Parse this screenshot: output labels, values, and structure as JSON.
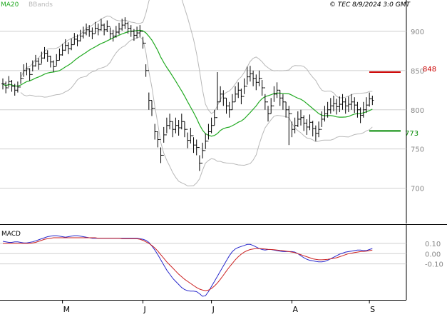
{
  "header": {
    "legend_ma20": "MA20",
    "legend_bbands": "BBands",
    "source": "© TEC 8/9/2024 3:0 GMT"
  },
  "colors": {
    "background": "#ffffff",
    "price_bar": "#000000",
    "ma20": "#22aa22",
    "bbands": "#b8b8b8",
    "grid": "#cfcfcf",
    "resistance": "#cc0000",
    "support": "#008800",
    "macd_line": "#2a2acc",
    "signal_line": "#cc2222",
    "axis_text": "#888888"
  },
  "levels": {
    "resistance_label": "848",
    "support_label": "773"
  },
  "x_axis": {
    "month_labels": [
      "M",
      "J",
      "J",
      "A",
      "S"
    ]
  },
  "chart_data": [
    {
      "type": "line",
      "subtype": "ohlc-bars",
      "title": "",
      "xlabel": "",
      "ylabel": "",
      "y_ticks": [
        "900",
        "850",
        "800",
        "750",
        "700"
      ],
      "ylim": [
        655,
        940
      ],
      "grid": true,
      "legend": "top-left",
      "resistance": 848,
      "support": 773,
      "month_labels": [
        "M",
        "J",
        "J",
        "A",
        "S"
      ],
      "month_label_bar_index": [
        20,
        47,
        70,
        97,
        123
      ],
      "close": [
        833,
        828,
        836,
        830,
        825,
        829,
        840,
        850,
        852,
        845,
        856,
        862,
        858,
        866,
        872,
        868,
        861,
        855,
        863,
        870,
        876,
        882,
        878,
        883,
        890,
        888,
        894,
        898,
        902,
        900,
        897,
        904,
        902,
        908,
        902,
        906,
        897,
        894,
        899,
        903,
        908,
        910,
        904,
        900,
        895,
        898,
        900,
        885,
        850,
        812,
        802,
        772,
        762,
        742,
        768,
        780,
        785,
        775,
        780,
        777,
        785,
        775,
        761,
        767,
        755,
        752,
        732,
        748,
        760,
        772,
        780,
        790,
        810,
        820,
        815,
        805,
        800,
        810,
        820,
        825,
        817,
        830,
        842,
        846,
        840,
        835,
        840,
        828,
        810,
        795,
        805,
        820,
        825,
        815,
        810,
        800,
        795,
        775,
        780,
        788,
        790,
        783,
        778,
        784,
        776,
        770,
        775,
        788,
        795,
        800,
        805,
        808,
        804,
        807,
        810,
        805,
        807,
        810,
        806,
        800,
        793,
        800,
        806,
        814,
        812
      ],
      "high": [
        840,
        836,
        843,
        838,
        833,
        836,
        848,
        858,
        860,
        853,
        863,
        870,
        866,
        874,
        880,
        876,
        869,
        863,
        871,
        878,
        884,
        890,
        886,
        891,
        898,
        896,
        902,
        906,
        910,
        908,
        905,
        912,
        910,
        916,
        910,
        914,
        905,
        902,
        907,
        911,
        916,
        918,
        912,
        908,
        903,
        906,
        908,
        893,
        858,
        822,
        812,
        782,
        772,
        752,
        778,
        790,
        795,
        785,
        790,
        787,
        795,
        785,
        771,
        777,
        765,
        762,
        742,
        758,
        770,
        782,
        790,
        800,
        848,
        830,
        825,
        815,
        810,
        820,
        830,
        835,
        827,
        840,
        855,
        856,
        850,
        845,
        850,
        838,
        820,
        805,
        815,
        830,
        835,
        825,
        820,
        810,
        805,
        785,
        790,
        798,
        800,
        793,
        788,
        794,
        786,
        780,
        785,
        798,
        805,
        810,
        815,
        818,
        814,
        817,
        820,
        815,
        817,
        820,
        816,
        810,
        803,
        810,
        816,
        822,
        818
      ],
      "low": [
        826,
        821,
        829,
        823,
        818,
        822,
        833,
        842,
        844,
        837,
        849,
        855,
        851,
        859,
        865,
        861,
        854,
        848,
        856,
        863,
        869,
        875,
        871,
        876,
        883,
        881,
        887,
        891,
        895,
        893,
        890,
        897,
        895,
        901,
        895,
        899,
        890,
        887,
        892,
        896,
        901,
        903,
        897,
        893,
        888,
        891,
        893,
        878,
        842,
        800,
        792,
        762,
        752,
        732,
        758,
        770,
        775,
        765,
        770,
        767,
        775,
        765,
        751,
        757,
        745,
        742,
        722,
        738,
        750,
        762,
        770,
        780,
        800,
        810,
        805,
        795,
        790,
        800,
        810,
        815,
        807,
        820,
        832,
        836,
        830,
        825,
        830,
        818,
        800,
        785,
        795,
        810,
        815,
        805,
        800,
        790,
        755,
        765,
        770,
        778,
        780,
        773,
        768,
        774,
        766,
        760,
        765,
        778,
        785,
        790,
        795,
        798,
        794,
        797,
        800,
        795,
        797,
        800,
        796,
        790,
        783,
        790,
        796,
        804,
        806
      ]
    },
    {
      "type": "line",
      "title": "MACD",
      "xlabel": "",
      "ylabel": "",
      "y_ticks": [
        "0.10",
        "0.00",
        "-0.10"
      ],
      "ylim": [
        -0.45,
        0.28
      ],
      "grid": true,
      "series": [
        {
          "name": "",
          "color": "#2a2acc",
          "values": [
            0.12,
            0.115,
            0.11,
            0.11,
            0.115,
            0.115,
            0.11,
            0.105,
            0.105,
            0.11,
            0.115,
            0.125,
            0.135,
            0.145,
            0.155,
            0.165,
            0.17,
            0.175,
            0.175,
            0.17,
            0.165,
            0.16,
            0.165,
            0.17,
            0.175,
            0.175,
            0.17,
            0.165,
            0.16,
            0.155,
            0.15,
            0.15,
            0.15,
            0.15,
            0.15,
            0.15,
            0.15,
            0.15,
            0.15,
            0.15,
            0.15,
            0.15,
            0.15,
            0.15,
            0.15,
            0.15,
            0.145,
            0.14,
            0.13,
            0.11,
            0.075,
            0.035,
            -0.01,
            -0.06,
            -0.11,
            -0.16,
            -0.2,
            -0.24,
            -0.27,
            -0.3,
            -0.33,
            -0.35,
            -0.36,
            -0.365,
            -0.365,
            -0.37,
            -0.39,
            -0.415,
            -0.41,
            -0.37,
            -0.32,
            -0.27,
            -0.22,
            -0.17,
            -0.12,
            -0.07,
            -0.02,
            0.02,
            0.045,
            0.06,
            0.07,
            0.08,
            0.09,
            0.09,
            0.08,
            0.065,
            0.05,
            0.04,
            0.035,
            0.04,
            0.04,
            0.035,
            0.03,
            0.025,
            0.02,
            0.02,
            0.02,
            0.02,
            0.015,
            0.0,
            -0.02,
            -0.04,
            -0.055,
            -0.065,
            -0.07,
            -0.075,
            -0.08,
            -0.08,
            -0.075,
            -0.065,
            -0.05,
            -0.035,
            -0.02,
            -0.005,
            0.005,
            0.015,
            0.02,
            0.025,
            0.03,
            0.035,
            0.035,
            0.03,
            0.03,
            0.04,
            0.05
          ]
        },
        {
          "name": "",
          "color": "#cc2222",
          "values": [
            0.1,
            0.1,
            0.1,
            0.1,
            0.1,
            0.1,
            0.1,
            0.1,
            0.1,
            0.1,
            0.105,
            0.11,
            0.12,
            0.13,
            0.14,
            0.145,
            0.15,
            0.155,
            0.155,
            0.155,
            0.155,
            0.155,
            0.155,
            0.155,
            0.155,
            0.155,
            0.155,
            0.155,
            0.155,
            0.155,
            0.155,
            0.155,
            0.15,
            0.15,
            0.15,
            0.15,
            0.15,
            0.15,
            0.15,
            0.15,
            0.145,
            0.145,
            0.145,
            0.145,
            0.145,
            0.145,
            0.14,
            0.13,
            0.115,
            0.1,
            0.08,
            0.055,
            0.025,
            -0.01,
            -0.045,
            -0.08,
            -0.11,
            -0.14,
            -0.17,
            -0.2,
            -0.225,
            -0.25,
            -0.27,
            -0.29,
            -0.31,
            -0.33,
            -0.345,
            -0.355,
            -0.36,
            -0.355,
            -0.34,
            -0.315,
            -0.285,
            -0.25,
            -0.21,
            -0.17,
            -0.13,
            -0.095,
            -0.06,
            -0.03,
            -0.005,
            0.015,
            0.03,
            0.04,
            0.045,
            0.05,
            0.05,
            0.048,
            0.045,
            0.042,
            0.04,
            0.038,
            0.035,
            0.032,
            0.03,
            0.025,
            0.02,
            0.015,
            0.01,
            0.0,
            -0.01,
            -0.02,
            -0.03,
            -0.04,
            -0.05,
            -0.055,
            -0.06,
            -0.06,
            -0.058,
            -0.055,
            -0.05,
            -0.045,
            -0.04,
            -0.03,
            -0.02,
            -0.01,
            0.0,
            0.005,
            0.01,
            0.015,
            0.02,
            0.022,
            0.025,
            0.03,
            0.035
          ]
        }
      ]
    }
  ]
}
